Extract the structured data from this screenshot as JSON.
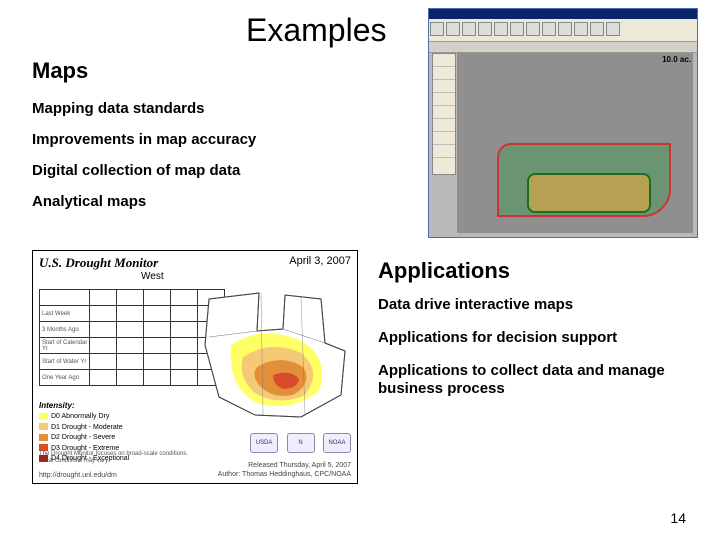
{
  "title": "Examples",
  "maps": {
    "heading": "Maps",
    "items": [
      "Mapping data standards",
      "Improvements in map accuracy",
      "Digital collection of map data",
      "Analytical maps"
    ]
  },
  "applications": {
    "heading": "Applications",
    "items": [
      "Data drive interactive maps",
      "Applications for decision support",
      "Applications to collect data and manage business process"
    ]
  },
  "page_number": "14",
  "gis_screenshot": {
    "scale_label": "10.0 ac."
  },
  "drought_monitor": {
    "title": "U.S. Drought Monitor",
    "date": "April 3, 2007",
    "region": "West",
    "legend_title": "Intensity:",
    "legend": [
      {
        "code": "D0",
        "label": "Abnormally Dry",
        "color": "#ffff66"
      },
      {
        "code": "D1",
        "label": "Drought - Moderate",
        "color": "#f5c976"
      },
      {
        "code": "D2",
        "label": "Drought - Severe",
        "color": "#e38f3a"
      },
      {
        "code": "D3",
        "label": "Drought - Extreme",
        "color": "#d94b2b"
      },
      {
        "code": "D4",
        "label": "Drought - Exceptional",
        "color": "#a51d15"
      }
    ],
    "table_rows": [
      "",
      "Last Week",
      "3 Months Ago",
      "Start of Calendar Yr",
      "Start of Water Yr",
      "One Year Ago"
    ],
    "footer_note": "The Drought Monitor focuses on broad-scale conditions. Local conditions may vary.",
    "url": "http://drought.unl.edu/dm",
    "released": "Released Thursday, April 5, 2007",
    "author": "Author: Thomas Heddinghaus, CPC/NOAA",
    "logos": [
      "USDA",
      "N",
      "NOAA"
    ]
  }
}
